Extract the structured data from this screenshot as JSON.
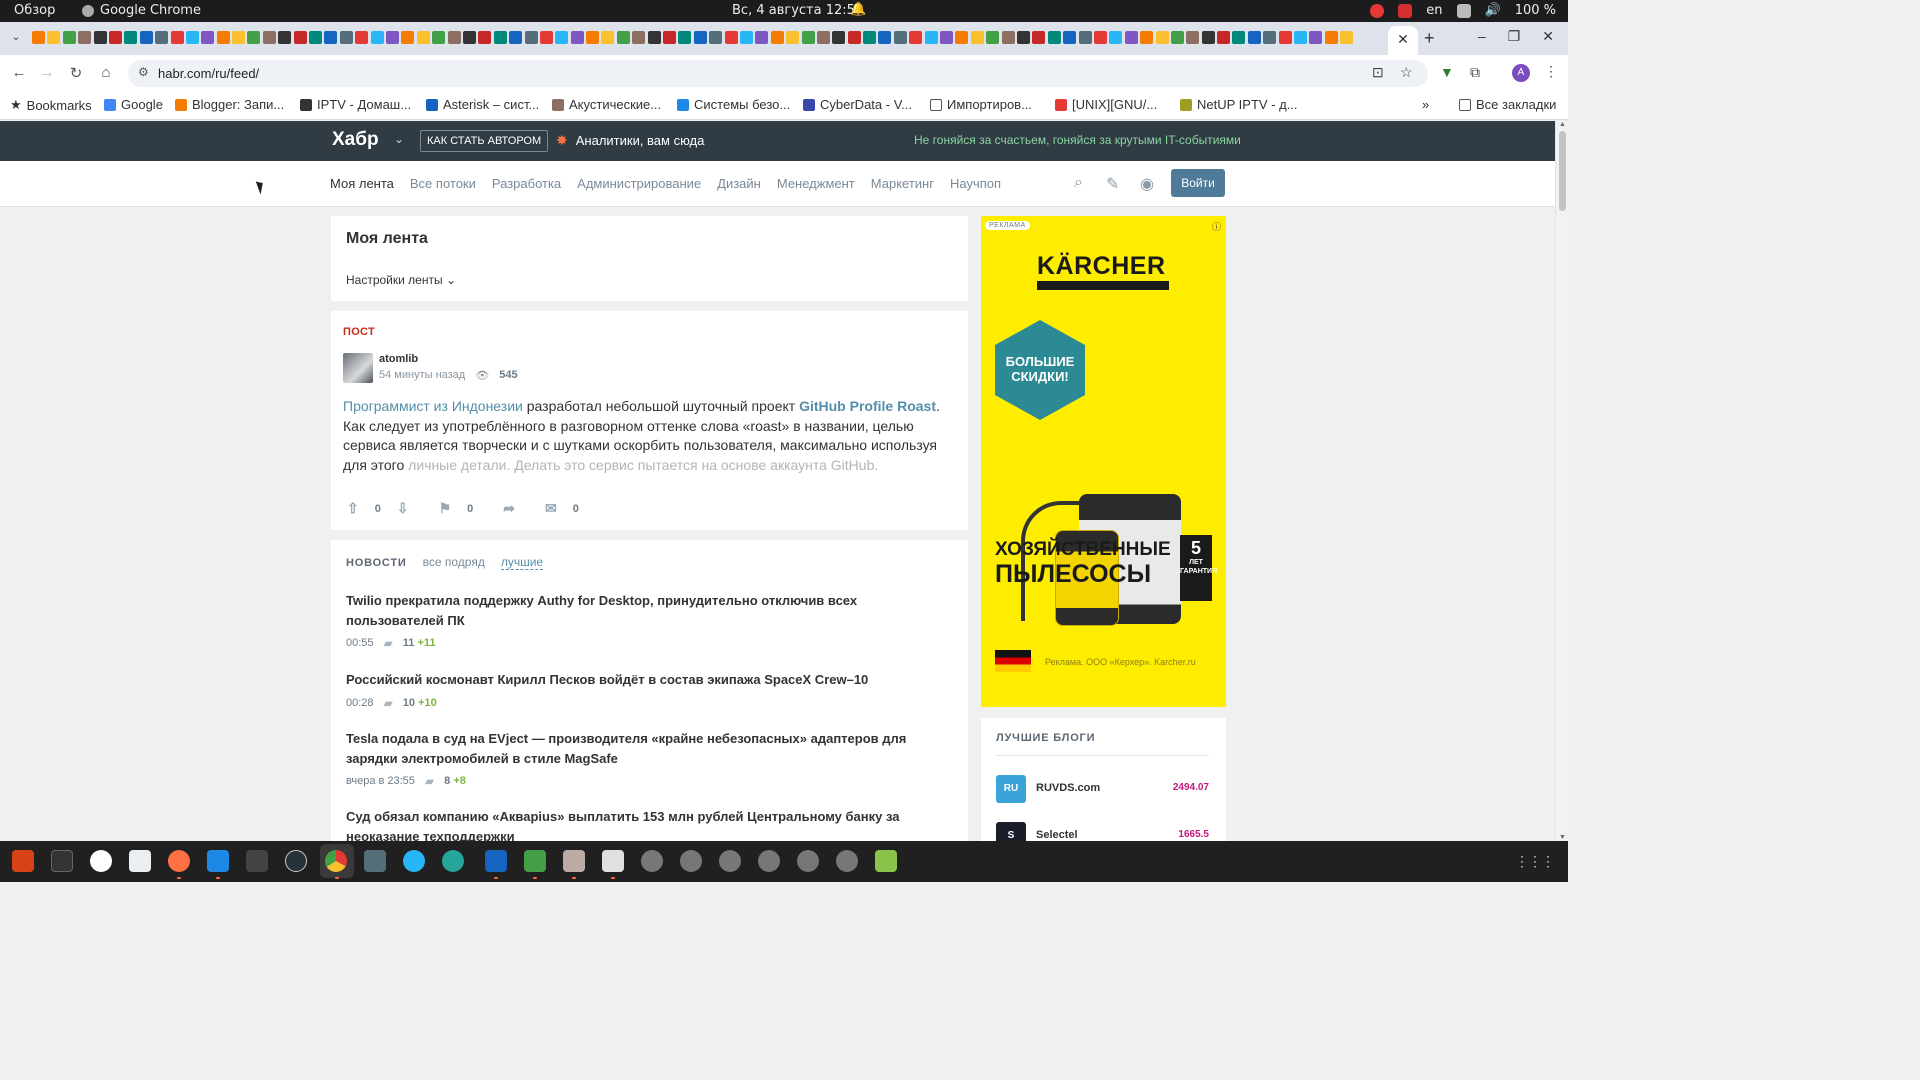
{
  "system_bar": {
    "activities": "Обзор",
    "app_name": "Google Chrome",
    "datetime": "Вс, 4 августа  12:52",
    "lang": "en",
    "battery": "100 %"
  },
  "browser": {
    "url": "habr.com/ru/feed/",
    "bookmarks": [
      "Bookmarks",
      "Google",
      "Blogger: Запи...",
      "IPTV - Домаш...",
      "Asterisk – сист...",
      "Акустические...",
      "Системы безо...",
      "CyberData - V...",
      "Импортиров...",
      "[UNIX][GNU/...",
      "NetUP IPTV - д..."
    ],
    "more_bookmarks": "»",
    "all_bookmarks": "Все закладки",
    "avatar_letter": "A"
  },
  "habr": {
    "logo": "Хабр",
    "become_author": "КАК СТАТЬ АВТОРОМ",
    "promo": "Аналитики, вам сюда",
    "slogan": "Не гоняйся за счастьем, гоняйся за крутыми IT-событиями",
    "nav": [
      "Моя лента",
      "Все потоки",
      "Разработка",
      "Администрирование",
      "Дизайн",
      "Менеджмент",
      "Маркетинг",
      "Научпоп"
    ],
    "login": "Войти",
    "feed_title": "Моя лента",
    "feed_settings": "Настройки ленты",
    "post": {
      "label": "ПОСТ",
      "author": "atomlib",
      "time": "54 минуты назад",
      "views": "545",
      "text_link1": "Программист из Индонезии",
      "text_part1": " разработал небольшой шуточный проект ",
      "text_link2": "GitHub Profile Roast",
      "text_part2": ". Как следует из употреблённого в разговорном оттенке слова «roast» в названии, целью сервиса является творчески и с шутками оскорбить пользователя, максимально используя для этого ",
      "text_fade": "личные детали. Делать это сервис пытается на основе аккаунта GitHub.",
      "votes": "0",
      "bookmarks": "0",
      "comments": "0"
    },
    "news": {
      "title": "НОВОСТИ",
      "tab_all": "все подряд",
      "tab_best": "лучшие",
      "items": [
        {
          "title": "Twilio прекратила поддержку Authy for Desktop, принудительно отключив всех пользователей ПК",
          "time": "00:55",
          "comments": "11",
          "new": "+11"
        },
        {
          "title": "Российский космонавт Кирилл Песков войдёт в состав экипажа SpaceX Crew–10",
          "time": "00:28",
          "comments": "10",
          "new": "+10"
        },
        {
          "title": "Tesla подала в суд на EVject — производителя «крайне небезопасных» адаптеров для зарядки электромобилей в стиле MagSafe",
          "time": "вчера в 23:55",
          "comments": "8",
          "new": "+8"
        },
        {
          "title": "Суд обязал компанию «Акварius» выплатить 153 млн рублей Центральному банку за неоказание техподдержки",
          "time": "",
          "comments": "",
          "new": ""
        }
      ]
    },
    "ad": {
      "tag": "РЕКЛАМА",
      "brand": "KÄRCHER",
      "hex_text": "БОЛЬШИЕ СКИДКИ!",
      "headline_1": "ХОЗЯЙСТВЕННЫЕ",
      "headline_2": "ПЫЛЕСОСЫ",
      "badge_num": "5",
      "badge_1": "ЛЕТ",
      "badge_2": "ГАРАНТИЯ",
      "legal": "Реклама. ООО «Керхер». Karcher.ru"
    },
    "blogs": {
      "title": "ЛУЧШИЕ БЛОГИ",
      "items": [
        {
          "name": "RUVDS.com",
          "rating": "2494.07",
          "logo": "RU",
          "color": "#3ba3d8"
        },
        {
          "name": "Selectel",
          "rating": "1665.5",
          "logo": "S",
          "color": "#1b1d2b"
        }
      ]
    }
  }
}
